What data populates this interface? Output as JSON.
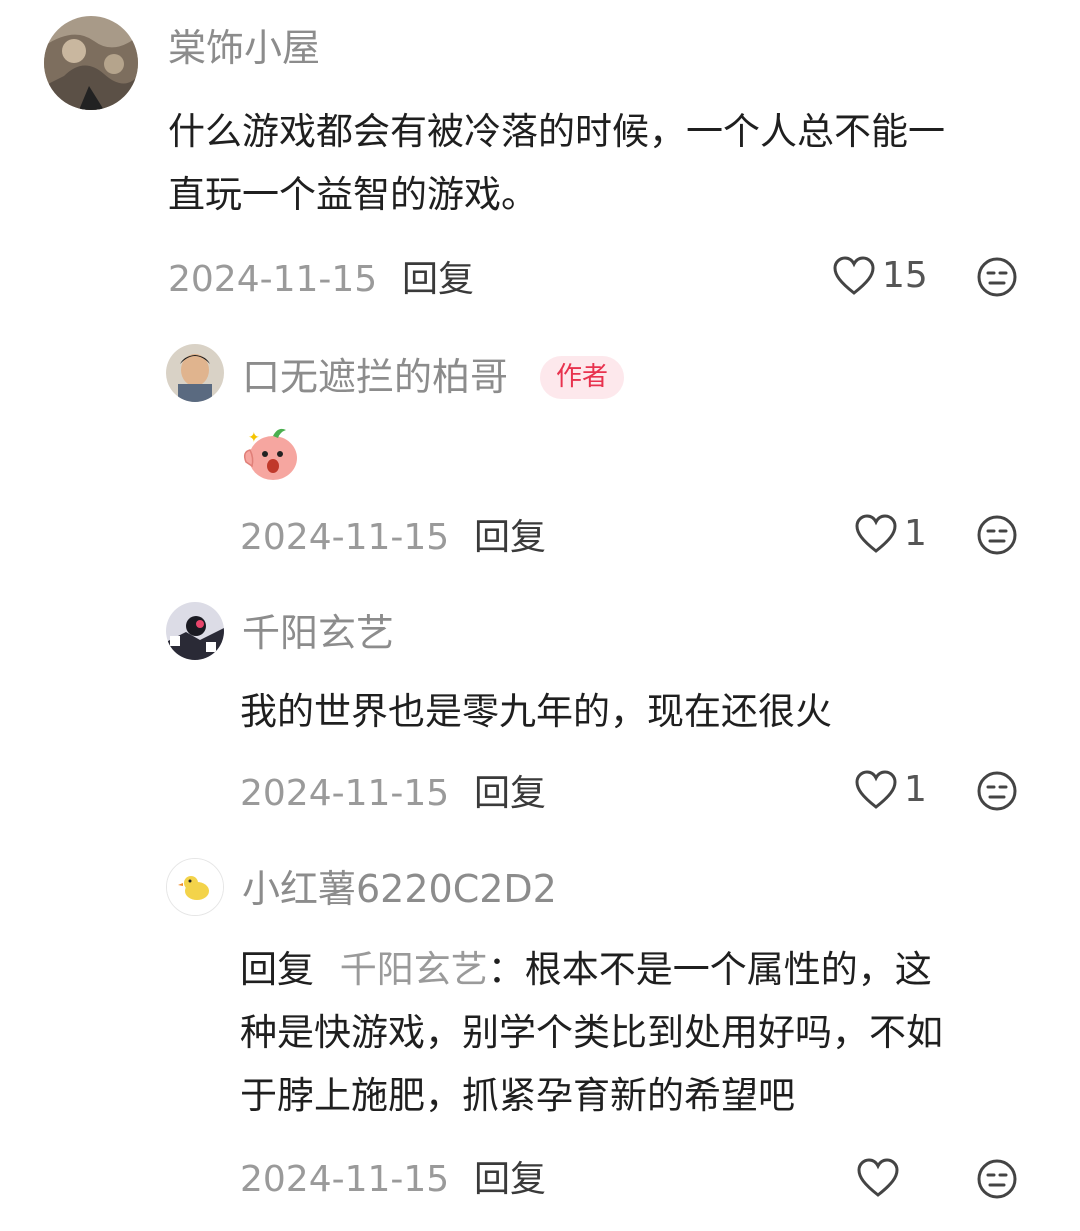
{
  "comments": [
    {
      "username": "棠饰小屋",
      "text_lines": [
        "什么游戏都会有被冷落的时候，一个人总不能一",
        "直玩一个益智的游戏。"
      ],
      "date": "2024-11-15",
      "reply_label": "回复",
      "likes": "15",
      "avatar_icon": "rock-photo-avatar"
    },
    {
      "username": "口无遮拦的柏哥",
      "badge": "作者",
      "sticker": "peach-shock-emoji",
      "date": "2024-11-15",
      "reply_label": "回复",
      "likes": "1",
      "avatar_icon": "child-photo-avatar"
    },
    {
      "username": "千阳玄艺",
      "text_lines": [
        "我的世界也是零九年的，现在还很火"
      ],
      "date": "2024-11-15",
      "reply_label": "回复",
      "likes": "1",
      "avatar_icon": "cartoon-avatar"
    },
    {
      "username": "小红薯6220C2D2",
      "reply_prefix": "回复",
      "reply_to": "千阳玄艺",
      "reply_colon": "：根本不是一个属性的，这",
      "text_lines": [
        "种是快游戏，别学个类比到处用好吗，不如",
        "于脖上施肥，抓紧孕育新的希望吧"
      ],
      "date": "2024-11-15",
      "reply_label": "回复",
      "likes": "",
      "avatar_icon": "duck-avatar"
    }
  ],
  "colors": {
    "badge_bg": "#fde8ec",
    "badge_text": "#e8324e",
    "muted": "#9a9a9a"
  }
}
